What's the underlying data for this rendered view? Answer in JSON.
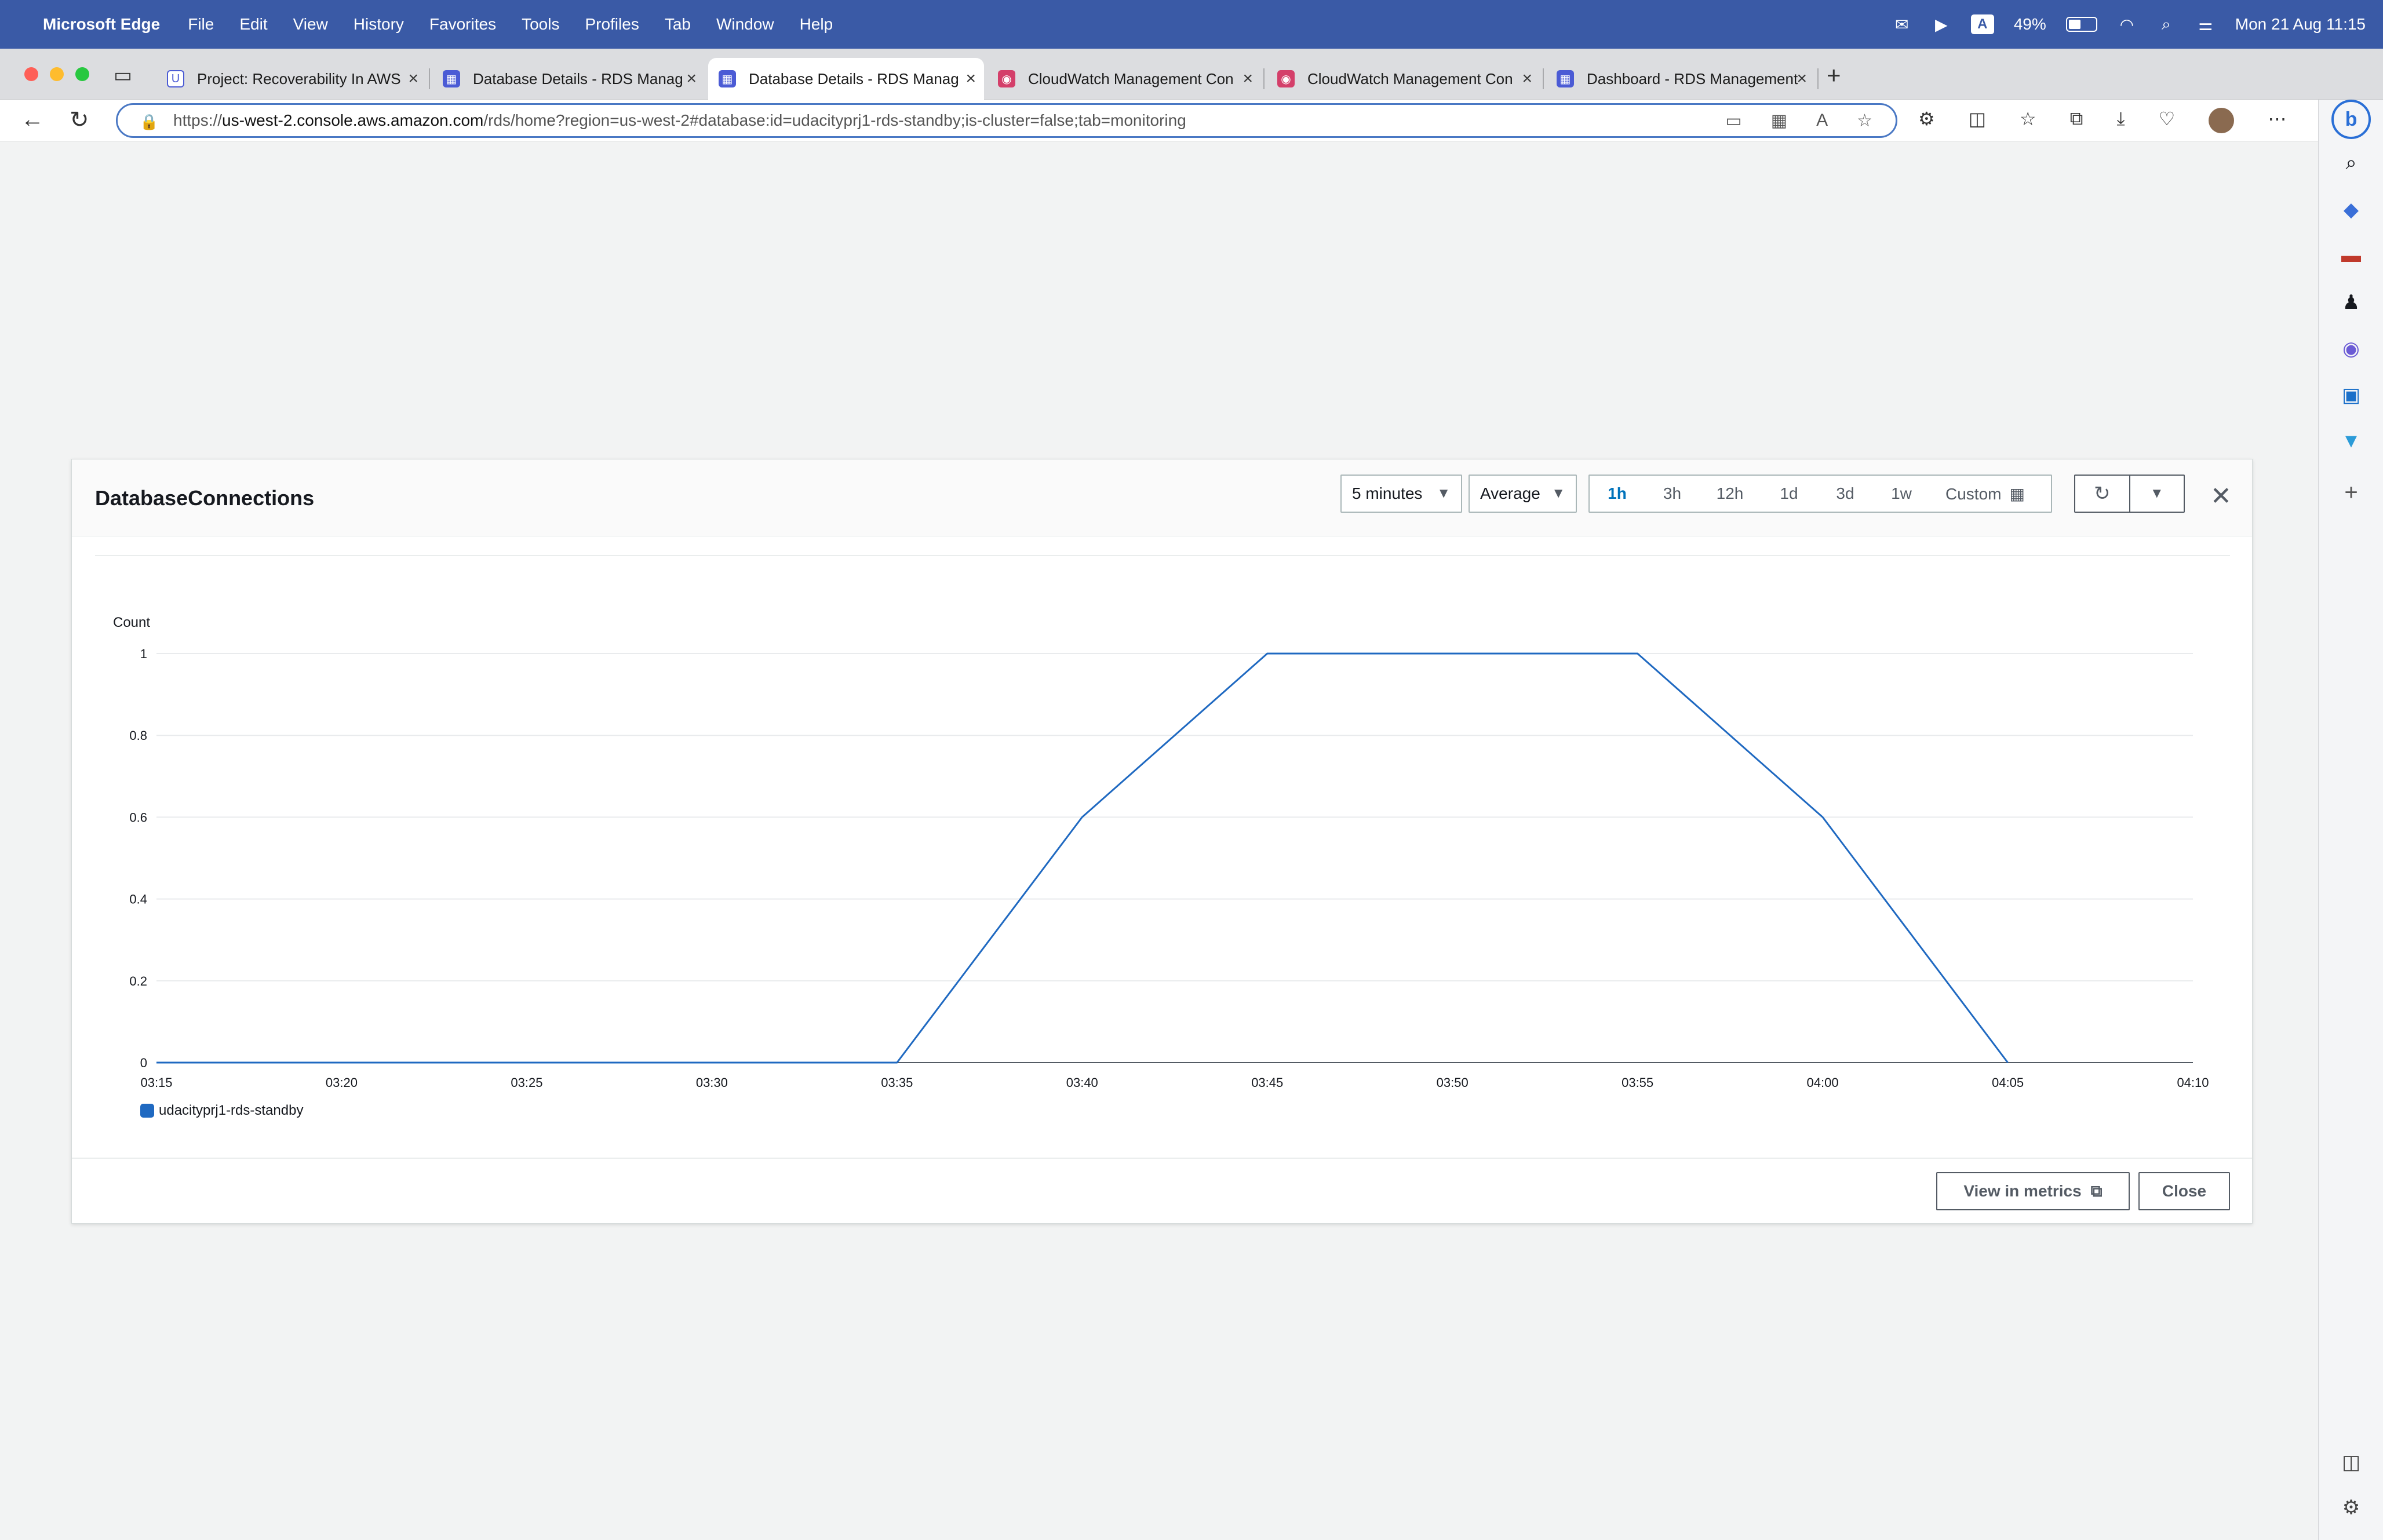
{
  "menubar": {
    "app_name": "Microsoft Edge",
    "items": [
      "File",
      "Edit",
      "View",
      "History",
      "Favorites",
      "Tools",
      "Profiles",
      "Tab",
      "Window",
      "Help"
    ],
    "battery": "49%",
    "input_source": "A",
    "clock": "Mon 21 Aug  11:15"
  },
  "tabs": [
    {
      "title": "Project: Recoverability In AWS",
      "icon": "udacity-icon",
      "color": "#4b5bd5"
    },
    {
      "title": "Database Details - RDS Manag",
      "icon": "rds-icon",
      "color": "#4b5bd5"
    },
    {
      "title": "Database Details - RDS Manag",
      "icon": "rds-icon",
      "color": "#4b5bd5",
      "active": true
    },
    {
      "title": "CloudWatch Management Con",
      "icon": "cloudwatch-icon",
      "color": "#d43f6a"
    },
    {
      "title": "CloudWatch Management Con",
      "icon": "cloudwatch-icon",
      "color": "#d43f6a"
    },
    {
      "title": "Dashboard - RDS Management",
      "icon": "rds-icon",
      "color": "#4b5bd5"
    }
  ],
  "address": {
    "scheme": "https://",
    "host": "us-west-2.console.aws.amazon.com",
    "path": "/rds/home?region=us-west-2#database:id=udacityprj1-rds-standby;is-cluster=false;tab=monitoring"
  },
  "modal": {
    "title": "DatabaseConnections",
    "period": "5 minutes",
    "statistic": "Average",
    "ranges": [
      "1h",
      "3h",
      "12h",
      "1d",
      "3d",
      "1w",
      "Custom"
    ],
    "active_range": "1h",
    "view_in_metrics": "View in metrics",
    "close": "Close"
  },
  "chart_data": {
    "type": "line",
    "title": "",
    "ylabel": "Count",
    "xlabel": "",
    "ylim": [
      0,
      1
    ],
    "yticks": [
      "0",
      "0.2",
      "0.4",
      "0.6",
      "0.8",
      "1"
    ],
    "x": [
      "03:15",
      "03:20",
      "03:25",
      "03:30",
      "03:35",
      "03:40",
      "03:45",
      "03:50",
      "03:55",
      "04:00",
      "04:05",
      "04:10"
    ],
    "series": [
      {
        "name": "udacityprj1-rds-standby",
        "color": "#1f69c1",
        "values": [
          0,
          0,
          0,
          0,
          0,
          0.6,
          1,
          1,
          1,
          0.6,
          0,
          null
        ]
      }
    ],
    "grid": true,
    "legend": "bottom-left"
  },
  "colors": {
    "menubar": "#3a5aa6",
    "accent": "#0073bb",
    "series": "#1f69c1"
  }
}
